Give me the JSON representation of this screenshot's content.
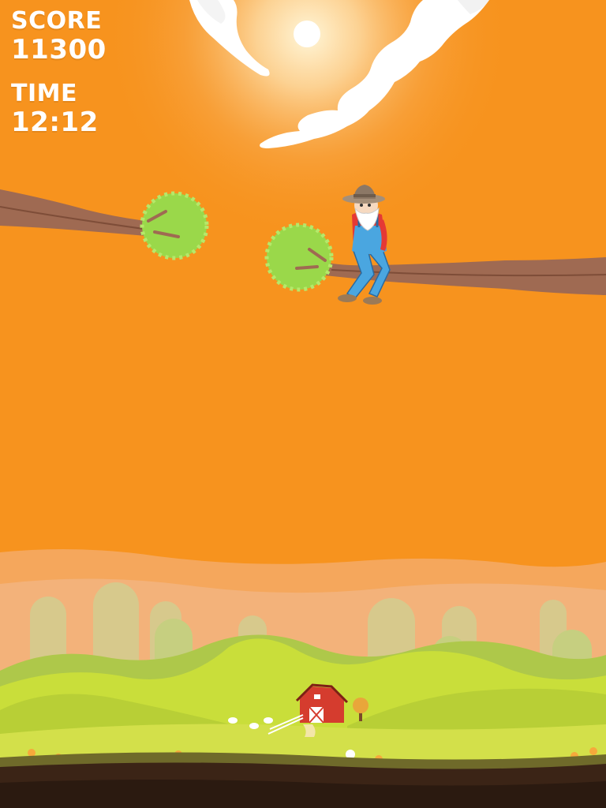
{
  "hud": {
    "score_label": "SCORE",
    "score_value": "11300",
    "time_label": "TIME",
    "time_value": "12:12"
  },
  "colors": {
    "sky": "#f7931e",
    "hills": "#c5dc3c",
    "leaves": "#9ad84a",
    "branch": "#9f6a52",
    "barn": "#d53c2e",
    "overalls": "#4aa6e0",
    "shirt": "#e53935"
  },
  "sprites": {
    "player": "old-farmer-character",
    "platforms": [
      "tree-branch-left",
      "tree-branch-right"
    ],
    "background": "farm-landscape"
  }
}
